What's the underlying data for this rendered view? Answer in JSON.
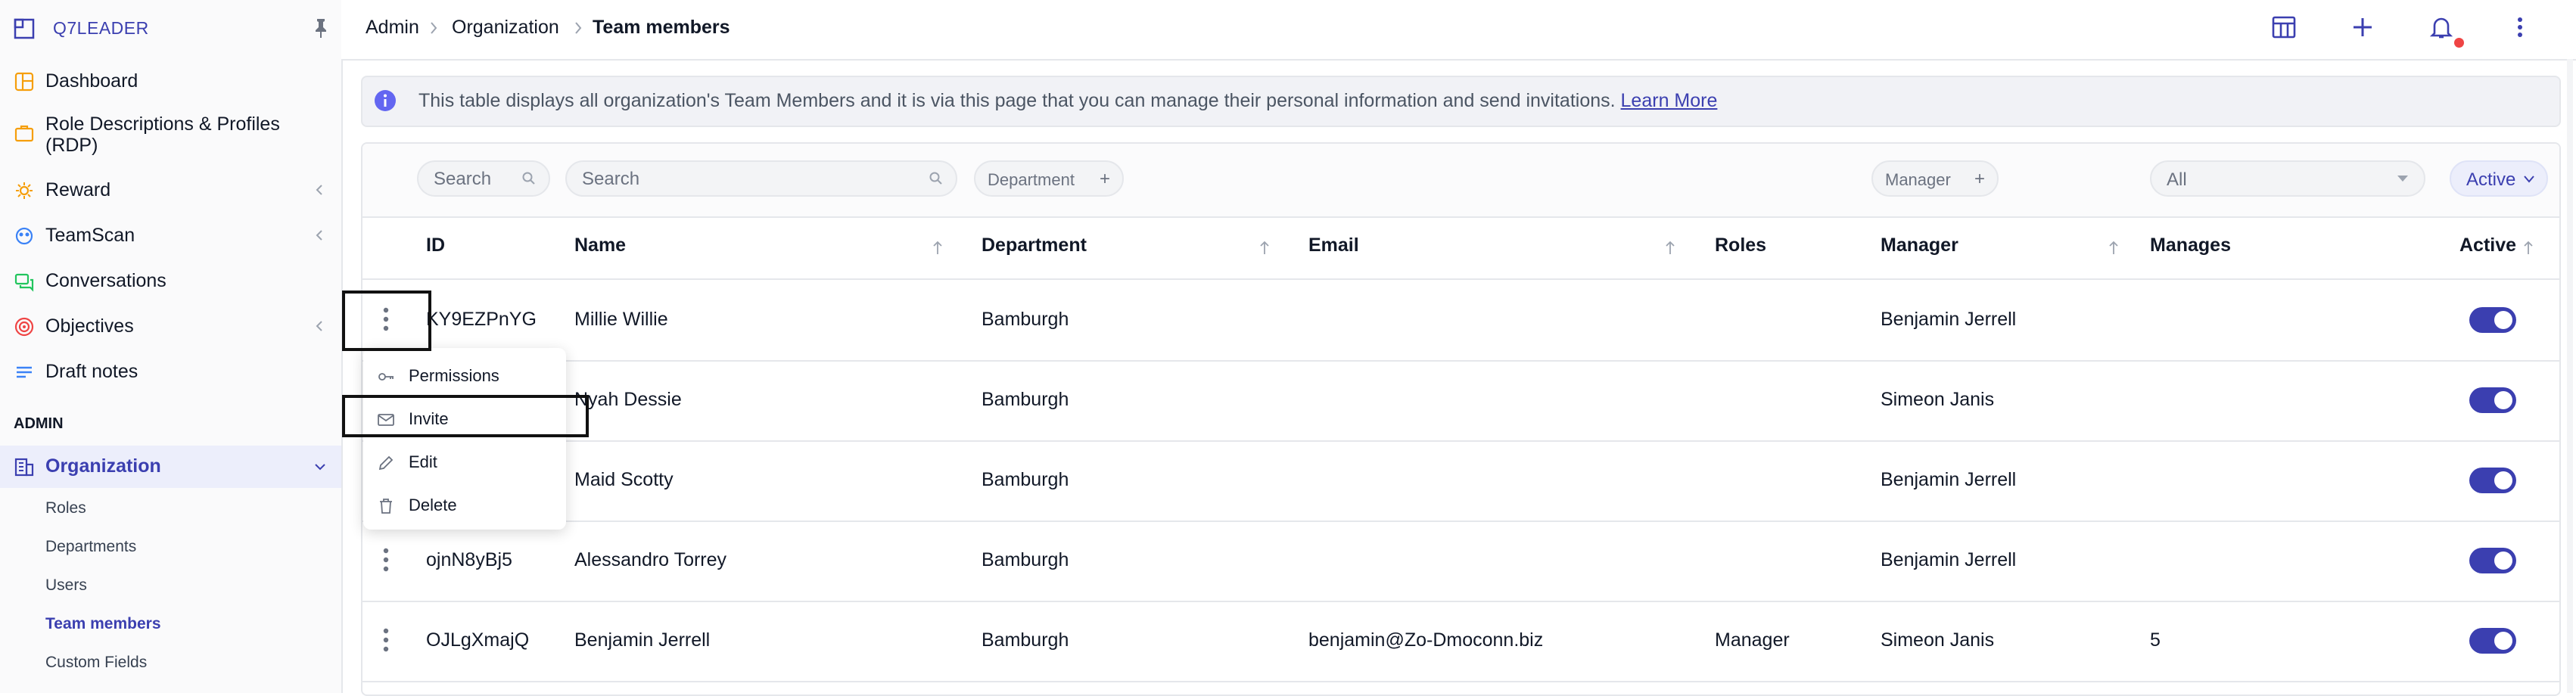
{
  "sidebar": {
    "brand": "Q7LEADER",
    "nav": [
      {
        "label": "Dashboard",
        "icon": "dashboard-icon"
      },
      {
        "label": "Role Descriptions & Profiles (RDP)",
        "icon": "briefcase-icon"
      },
      {
        "label": "Reward",
        "icon": "reward-icon"
      },
      {
        "label": "TeamScan",
        "icon": "teamscan-icon"
      },
      {
        "label": "Conversations",
        "icon": "chat-icon"
      },
      {
        "label": "Objectives",
        "icon": "target-icon"
      },
      {
        "label": "Draft notes",
        "icon": "notes-icon"
      }
    ],
    "section_label": "ADMIN",
    "organization": {
      "label": "Organization",
      "children": [
        "Roles",
        "Departments",
        "Users",
        "Team members",
        "Custom Fields"
      ],
      "active_child": "Team members"
    }
  },
  "header": {
    "breadcrumb": [
      "Admin",
      "Organization",
      "Team members"
    ]
  },
  "banner": {
    "text": "This table displays all organization's Team Members and it is via this page that you can manage their personal information and send invitations.",
    "link": "Learn More"
  },
  "filters": {
    "id_placeholder": "Search",
    "name_placeholder": "Search",
    "department_label": "Department",
    "manager_label": "Manager",
    "manages_value": "All",
    "active_value": "Active"
  },
  "table": {
    "columns": [
      "ID",
      "Name",
      "Department",
      "Email",
      "Roles",
      "Manager",
      "Manages",
      "Active"
    ],
    "rows": [
      {
        "id": "KY9EZPnYG",
        "name": "Millie Willie",
        "department": "Bamburgh",
        "email": "",
        "roles": "",
        "manager": "Benjamin Jerrell",
        "manages": "",
        "active": true
      },
      {
        "id": "",
        "name": "Nyah Dessie",
        "department": "Bamburgh",
        "email": "",
        "roles": "",
        "manager": "Simeon Janis",
        "manages": "",
        "active": true
      },
      {
        "id": "",
        "name": "Maid Scotty",
        "department": "Bamburgh",
        "email": "",
        "roles": "",
        "manager": "Benjamin Jerrell",
        "manages": "",
        "active": true
      },
      {
        "id": "ojnN8yBj5",
        "name": "Alessandro Torrey",
        "department": "Bamburgh",
        "email": "",
        "roles": "",
        "manager": "Benjamin Jerrell",
        "manages": "",
        "active": true
      },
      {
        "id": "OJLgXmajQ",
        "name": "Benjamin Jerrell",
        "department": "Bamburgh",
        "email": "benjamin@Zo-Dmoconn.biz",
        "roles": "Manager",
        "manager": "Simeon Janis",
        "manages": "5",
        "active": true
      }
    ]
  },
  "row_menu": {
    "items": [
      {
        "label": "Permissions",
        "icon": "key-icon"
      },
      {
        "label": "Invite",
        "icon": "mail-icon"
      },
      {
        "label": "Edit",
        "icon": "pencil-icon"
      },
      {
        "label": "Delete",
        "icon": "trash-icon"
      }
    ]
  },
  "colors": {
    "accent": "#3b3fb0",
    "accent_light": "#eceefb",
    "notification": "#ef4444"
  }
}
